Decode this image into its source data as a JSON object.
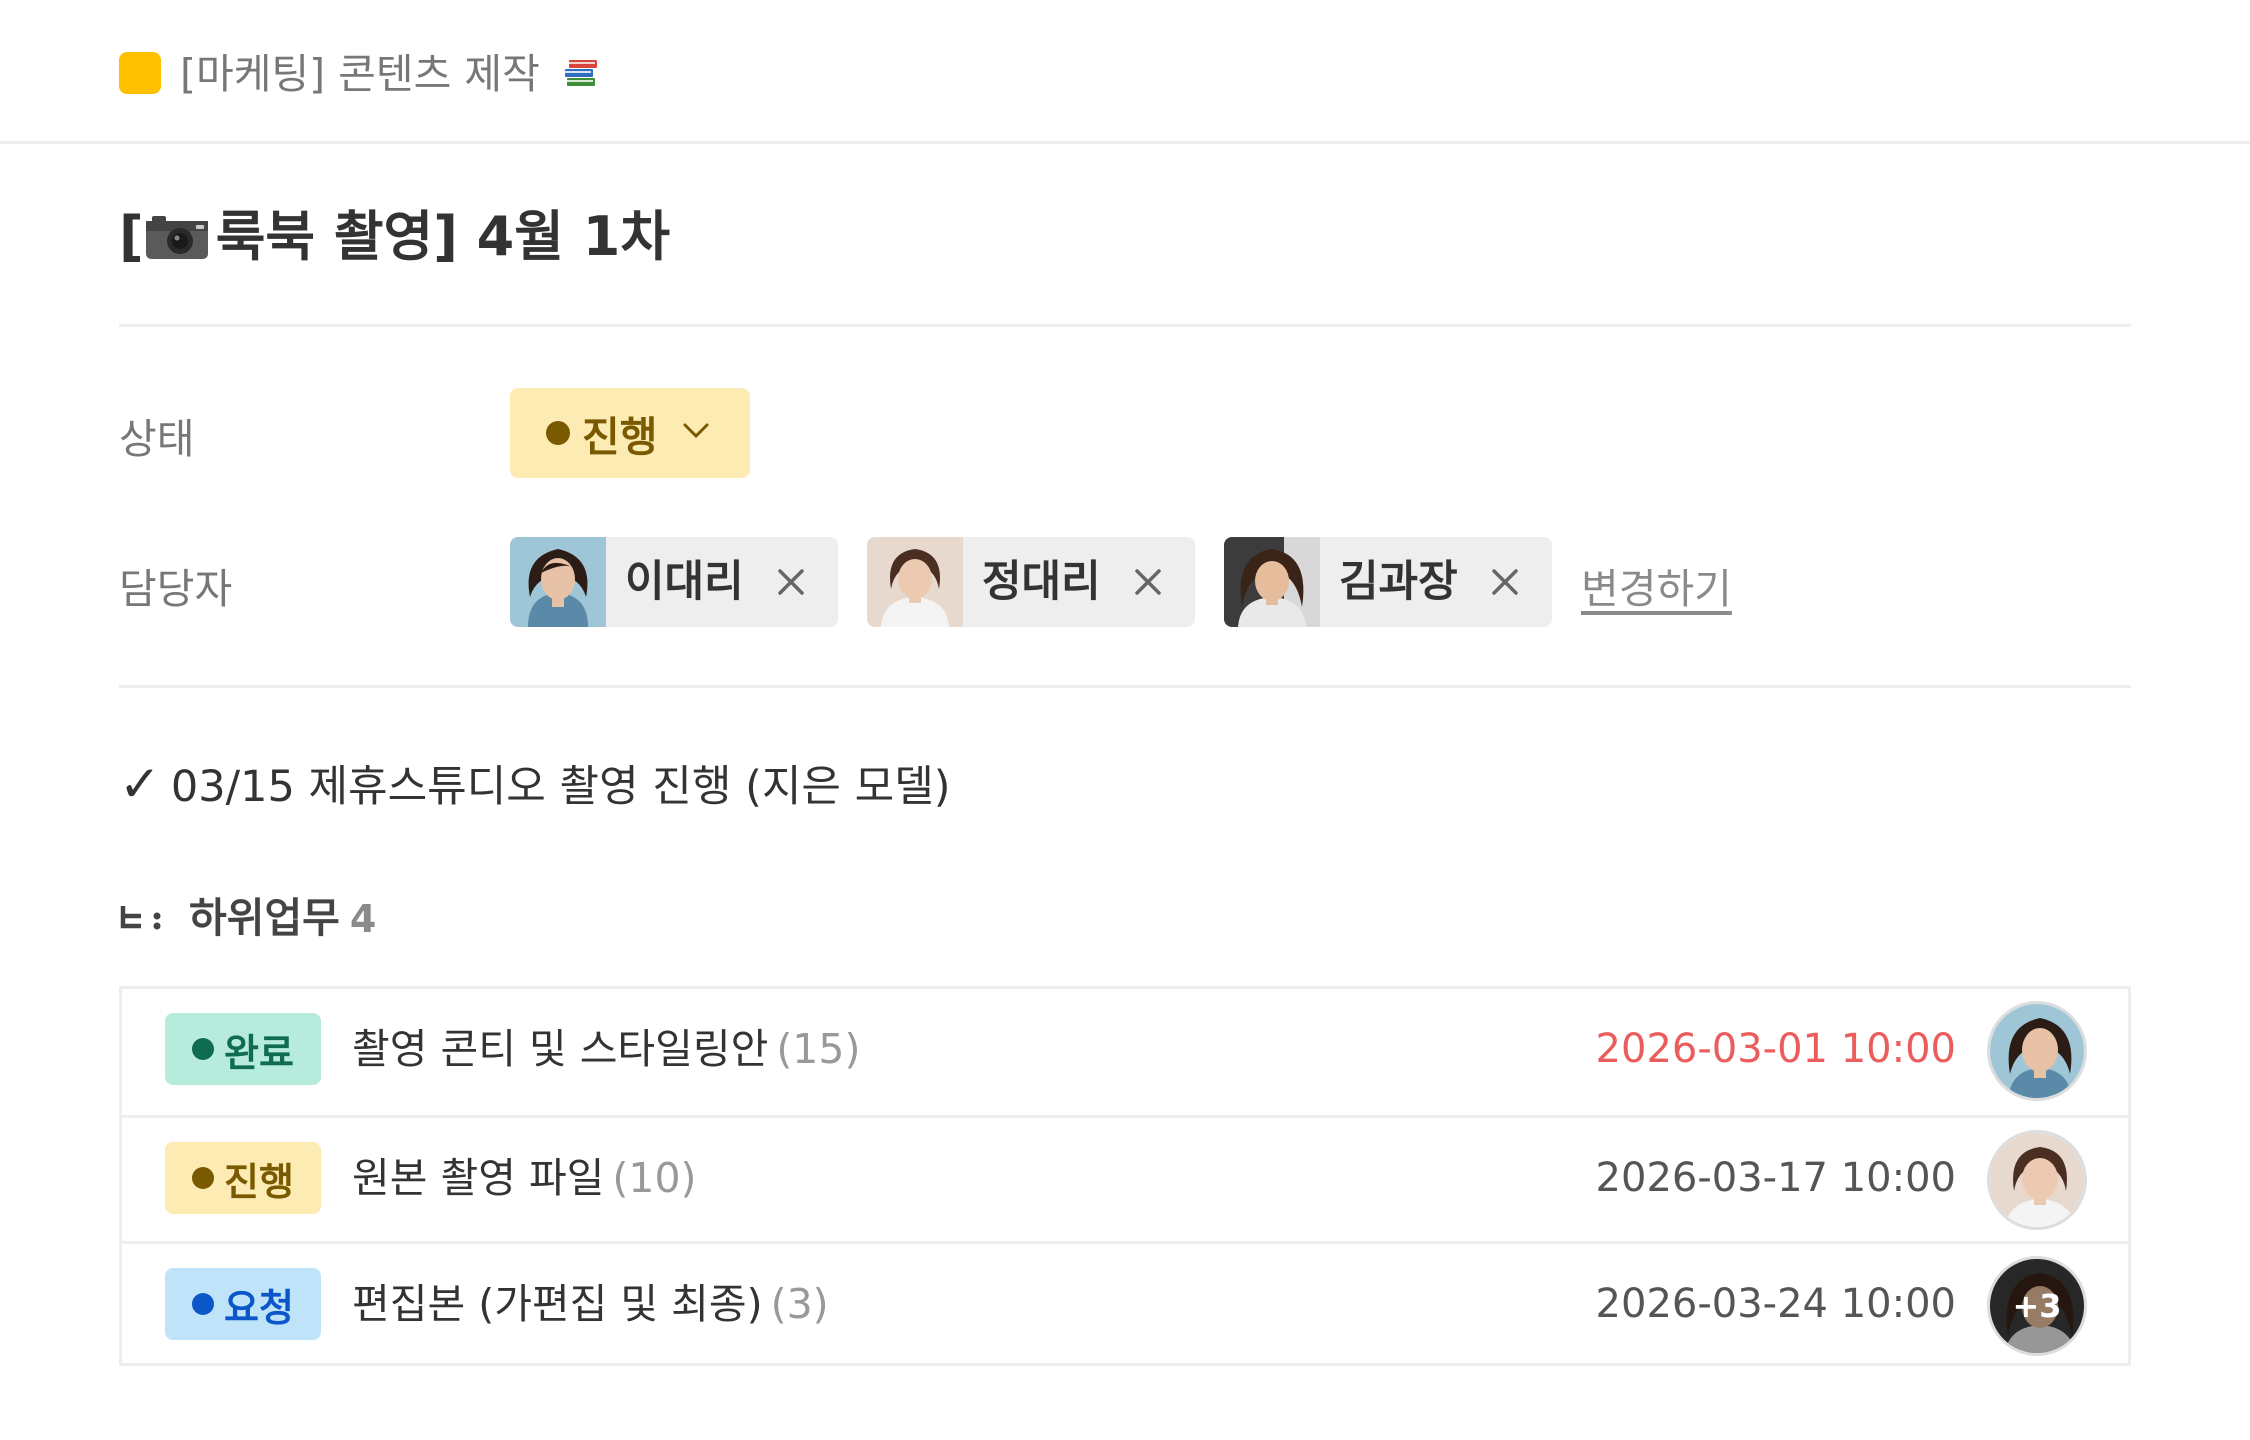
{
  "header": {
    "project_title": "[마케팅] 콘텐츠 제작",
    "project_icon": "books-emoji",
    "project_color": "#ffc000"
  },
  "task": {
    "title_prefix": "[",
    "title_text": "룩북 촬영] 4월 1차",
    "title_icon": "camera-emoji"
  },
  "properties": {
    "status_label": "상태",
    "status_value": "진행",
    "status_color": "#7a5a00",
    "status_bg": "#fcecb4",
    "assignee_label": "담당자",
    "assignees": [
      {
        "name": "이대리"
      },
      {
        "name": "정대리"
      },
      {
        "name": "김과장"
      }
    ],
    "change_link": "변경하기"
  },
  "note": {
    "check": "✓",
    "text": "03/15 제휴스튜디오 촬영 진행 (지은 모델)"
  },
  "subtasks": {
    "label": "하위업무",
    "count": "4",
    "rows": [
      {
        "status": "완료",
        "status_color": "#0f6b52",
        "status_bg": "#b7ebdc",
        "name": "촬영 콘티 및 스타일링안",
        "count": "(15)",
        "date": "2026-03-01 10:00",
        "date_color": "#eb5c5c",
        "avatar_extra": ""
      },
      {
        "status": "진행",
        "status_color": "#7a5a00",
        "status_bg": "#fcecb4",
        "name": "원본 촬영 파일",
        "count": "(10)",
        "date": "2026-03-17 10:00",
        "date_color": "#555555",
        "avatar_extra": ""
      },
      {
        "status": "요청",
        "status_color": "#0b57c9",
        "status_bg": "#bfe4fa",
        "name": "편집본 (가편집 및 최종)",
        "count": "(3)",
        "date": "2026-03-24 10:00",
        "date_color": "#555555",
        "avatar_extra": "+3"
      }
    ]
  }
}
